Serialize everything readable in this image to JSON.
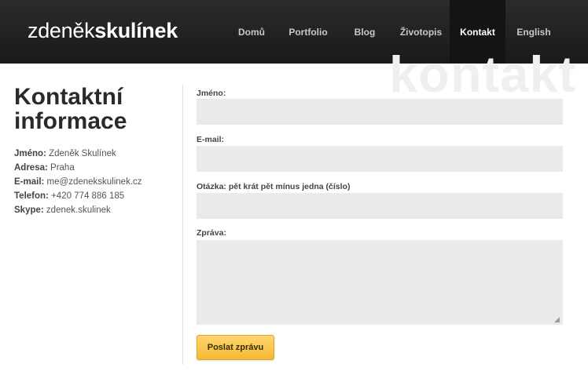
{
  "logo": {
    "light": "zdeněk",
    "bold": "skulínek"
  },
  "nav": {
    "items": [
      {
        "label": "Domů"
      },
      {
        "label": "Portfolio"
      },
      {
        "label": "Blog"
      },
      {
        "label": "Životopis"
      },
      {
        "label": "Kontakt",
        "active": true
      },
      {
        "label": "English"
      }
    ]
  },
  "watermark": "kontakt",
  "contact": {
    "title_line1": "Kontaktní",
    "title_line2": "informace",
    "rows": [
      {
        "label": "Jméno:",
        "value": "Zdeněk Skulínek"
      },
      {
        "label": "Adresa:",
        "value": "Praha"
      },
      {
        "label": "E-mail:",
        "value": "me@zdenekskulinek.cz"
      },
      {
        "label": "Telefon:",
        "value": "+420 774 886 185"
      },
      {
        "label": "Skype:",
        "value": "zdenek.skulinek"
      }
    ]
  },
  "form": {
    "name_label": "Jméno:",
    "name_value": "",
    "email_label": "E-mail:",
    "email_value": "",
    "question_label": "Otázka: pět krát pět mínus jedna (číslo)",
    "question_value": "",
    "message_label": "Zpráva:",
    "message_value": "",
    "submit_label": "Poslat zprávu"
  },
  "colors": {
    "header_bg": "#222222",
    "active_nav_bg": "#141414",
    "field_bg": "#eaeaea",
    "button_accent": "#f6b833"
  }
}
